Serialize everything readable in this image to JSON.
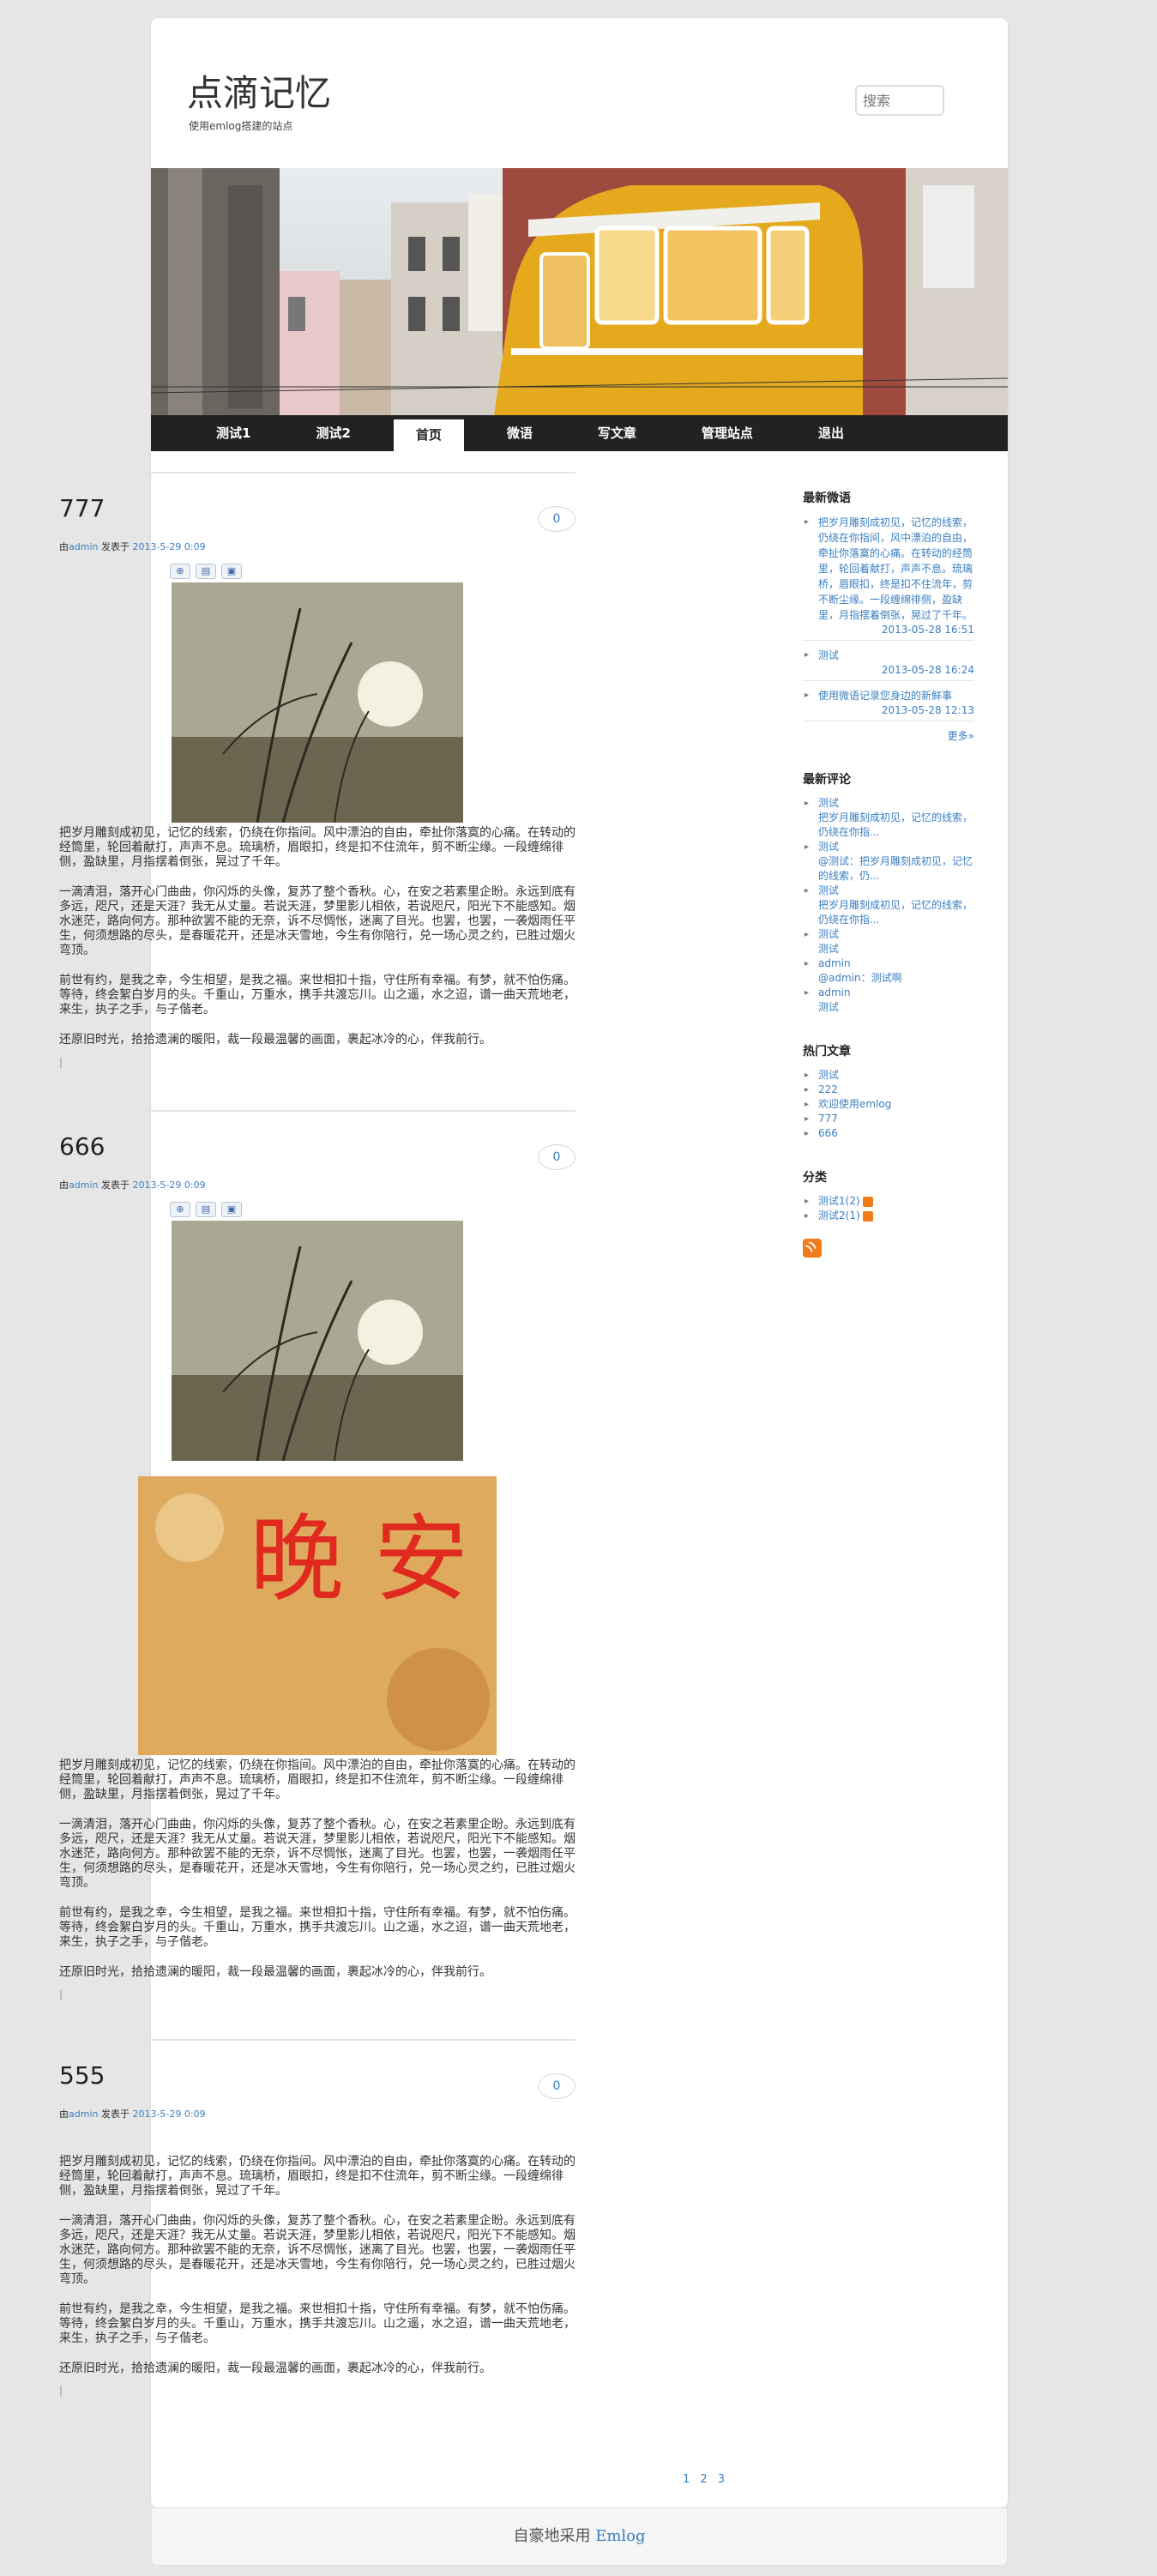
{
  "header": {
    "site_title": "点滴记忆",
    "site_desc": "使用emlog搭建的站点",
    "search_placeholder": "搜索"
  },
  "nav": [
    "测试1",
    "测试2",
    "首页",
    "微语",
    "写文章",
    "管理站点",
    "退出"
  ],
  "posts": [
    {
      "title": "777",
      "meta_by": "由",
      "author": "admin",
      "meta_posted": " 发表于 ",
      "date": "2013-5-29 0:09",
      "comments": "0",
      "paragraphs": [
        "把岁月雕刻成初见，记忆的线索，仍绕在你指间。风中漂泊的自由，牵扯你落寞的心痛。在转动的经筒里，轮回着献打，声声不息。琉璃桥，眉眼扣，终是扣不住流年，剪不断尘缘。一段缠绵徘侧，盈缺里，月指摆着倒张，晃过了千年。",
        "一滴清泪，落开心门曲曲，你闪烁的头像，复苏了整个香秋。心，在安之若素里企盼。永远到底有多远，咫尺，还是天涯？我无从丈量。若说天涯，梦里影儿相依，若说咫尺，阳光下不能感知。烟水迷茫，路向何方。那种欲罢不能的无奈，诉不尽惆怅，迷离了目光。也罢，也罢，一袭烟雨任平生，何须想路的尽头，是春暖花开，还是冰天雪地，今生有你陪行，兑一场心灵之约，已胜过烟火弯顶。",
        "前世有约，是我之幸，今生相望，是我之福。来世相扣十指，守住所有幸福。有梦，就不怕伤痛。等待，终会絮白岁月的头。千重山，万重水，携手共渡忘川。山之遥，水之迢，谱一曲天荒地老，来生，执子之手，与子偕老。",
        "还原旧时光，拾拾遗澜的暖阳，裁一段最温馨的画面，裹起冰冷的心，伴我前行。"
      ]
    },
    {
      "title": "666",
      "meta_by": "由",
      "author": "admin",
      "meta_posted": " 发表于 ",
      "date": "2013-5-29 0:09",
      "comments": "0",
      "image_text": "晚 安",
      "paragraphs": [
        "把岁月雕刻成初见，记忆的线索，仍绕在你指间。风中漂泊的自由，牵扯你落寞的心痛。在转动的经筒里，轮回着献打，声声不息。琉璃桥，眉眼扣，终是扣不住流年，剪不断尘缘。一段缠绵徘侧，盈缺里，月指摆着倒张，晃过了千年。",
        "一滴清泪，落开心门曲曲，你闪烁的头像，复苏了整个香秋。心，在安之若素里企盼。永远到底有多远，咫尺，还是天涯？我无从丈量。若说天涯，梦里影儿相依，若说咫尺，阳光下不能感知。烟水迷茫，路向何方。那种欲罢不能的无奈，诉不尽惆怅，迷离了目光。也罢，也罢，一袭烟雨任平生，何须想路的尽头，是春暖花开，还是冰天雪地，今生有你陪行，兑一场心灵之约，已胜过烟火弯顶。",
        "前世有约，是我之幸，今生相望，是我之福。来世相扣十指，守住所有幸福。有梦，就不怕伤痛。等待，终会絮白岁月的头。千重山，万重水，携手共渡忘川。山之遥，水之迢，谱一曲天荒地老，来生，执子之手，与子偕老。",
        "还原旧时光，拾拾遗澜的暖阳，裁一段最温馨的画面，裹起冰冷的心，伴我前行。"
      ]
    },
    {
      "title": "555",
      "meta_by": "由",
      "author": "admin",
      "meta_posted": " 发表于 ",
      "date": "2013-5-29 0:09",
      "comments": "0",
      "paragraphs": [
        "把岁月雕刻成初见，记忆的线索，仍绕在你指间。风中漂泊的自由，牵扯你落寞的心痛。在转动的经筒里，轮回着献打，声声不息。琉璃桥，眉眼扣，终是扣不住流年，剪不断尘缘。一段缠绵徘侧，盈缺里，月指摆着倒张，晃过了千年。",
        "一滴清泪，落开心门曲曲，你闪烁的头像，复苏了整个香秋。心，在安之若素里企盼。永远到底有多远，咫尺，还是天涯？我无从丈量。若说天涯，梦里影儿相依，若说咫尺，阳光下不能感知。烟水迷茫，路向何方。那种欲罢不能的无奈，诉不尽惆怅，迷离了目光。也罢，也罢，一袭烟雨任平生，何须想路的尽头，是春暖花开，还是冰天雪地，今生有你陪行，兑一场心灵之约，已胜过烟火弯顶。",
        "前世有约，是我之幸，今生相望，是我之福。来世相扣十指，守住所有幸福。有梦，就不怕伤痛。等待，终会絮白岁月的头。千重山，万重水，携手共渡忘川。山之遥，水之迢，谱一曲天荒地老，来生，执子之手，与子偕老。",
        "还原旧时光，拾拾遗澜的暖阳，裁一段最温馨的画面，裹起冰冷的心，伴我前行。"
      ]
    }
  ],
  "pager": "1 2 3",
  "sidebar": {
    "twitter_title": "最新微语",
    "twitter": [
      {
        "text": "把岁月雕刻成初见，记忆的线索，仍绕在你指间，风中漂泊的自由，牵扯你落寞的心痛。在转动的经筒里，轮回着献打，声声不息。琉璃桥，眉眼扣，终是扣不住流年，剪不断尘缘。一段缠绵徘侧，盈缺里，月指摆着倒张，晃过了千年。",
        "date": "2013-05-28 16:51"
      },
      {
        "text": "测试",
        "date": "2013-05-28 16:24"
      },
      {
        "text": "使用微语记录您身边的新鲜事",
        "date": "2013-05-28 12:13"
      }
    ],
    "more": "更多»",
    "comments_title": "最新评论",
    "comments": [
      {
        "name": "测试",
        "text": "把岁月雕刻成初见，记忆的线索，仍绕在你指..."
      },
      {
        "name": "测试",
        "text": "@测试：把岁月雕刻成初见，记忆的线索，仍..."
      },
      {
        "name": "测试",
        "text": "把岁月雕刻成初见，记忆的线索，仍绕在你指..."
      },
      {
        "name": "测试",
        "text": "测试"
      },
      {
        "name": "admin",
        "text": "@admin：测试啊"
      },
      {
        "name": "admin",
        "text": "测试"
      }
    ],
    "hot_title": "热门文章",
    "hot": [
      "测试",
      "222",
      "欢迎使用emlog",
      "777",
      "666"
    ],
    "cat_title": "分类",
    "cats": [
      "测试1(2)",
      "测试2(1)"
    ]
  },
  "footer": {
    "prefix": "自豪地采用 ",
    "link": "Emlog"
  },
  "colors": {
    "link": "#3a7fc1",
    "nav_bg": "#222222",
    "rss": "#f07c1c"
  }
}
